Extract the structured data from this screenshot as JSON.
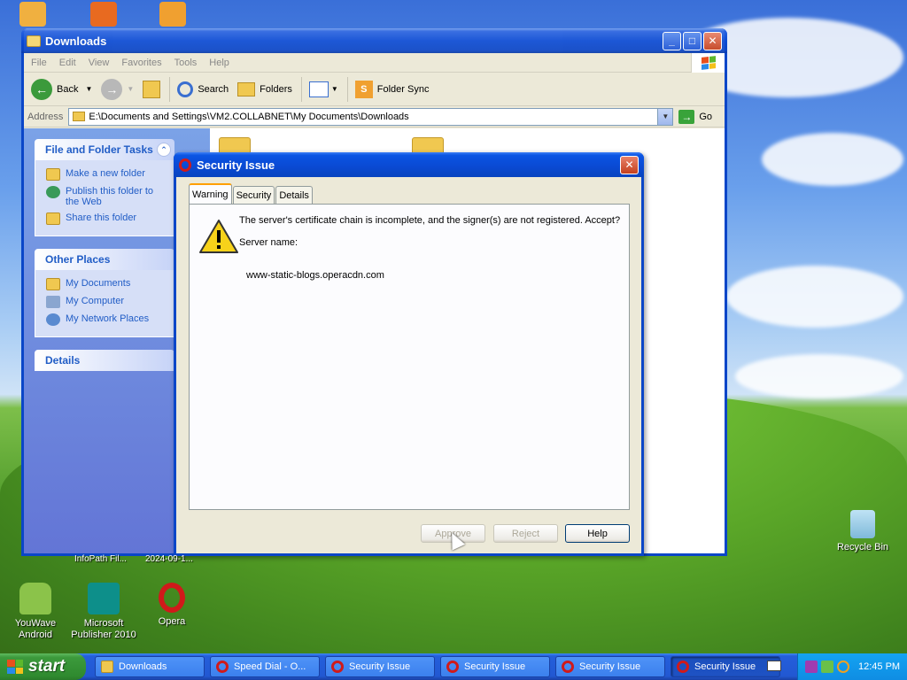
{
  "explorer": {
    "title": "Downloads",
    "menu": [
      "File",
      "Edit",
      "View",
      "Favorites",
      "Tools",
      "Help"
    ],
    "toolbar": {
      "back": "Back",
      "search": "Search",
      "folders": "Folders",
      "folder_sync": "Folder Sync"
    },
    "address": {
      "label": "Address",
      "path": "E:\\Documents and Settings\\VM2.COLLABNET\\My Documents\\Downloads",
      "go": "Go"
    },
    "file_tasks": {
      "header": "File and Folder Tasks",
      "items": [
        "Make a new folder",
        "Publish this folder to the Web",
        "Share this folder"
      ]
    },
    "other_places": {
      "header": "Other Places",
      "items": [
        "My Documents",
        "My Computer",
        "My Network Places"
      ]
    },
    "details": {
      "header": "Details"
    }
  },
  "dialog": {
    "title": "Security Issue",
    "tabs": [
      "Warning",
      "Security",
      "Details"
    ],
    "message": "The server's certificate chain is incomplete, and the signer(s) are not registered. Accept?",
    "server_label": "Server name:",
    "server_name": "www-static-blogs.operacdn.com",
    "buttons": {
      "approve": "Approve",
      "reject": "Reject",
      "help": "Help"
    }
  },
  "desktop": {
    "icons": [
      {
        "label": "YouWave Android"
      },
      {
        "label": "Microsoft Publisher 2010"
      },
      {
        "label": "Opera"
      },
      {
        "label": "Recycle Bin"
      }
    ],
    "partial_labels": [
      "InfoPath Fil...",
      "2024-09-1..."
    ]
  },
  "taskbar": {
    "start": "start",
    "items": [
      "Downloads",
      "Speed Dial - O...",
      "Security Issue",
      "Security Issue",
      "Security Issue",
      "Security Issue"
    ],
    "clock": "12:45 PM"
  }
}
